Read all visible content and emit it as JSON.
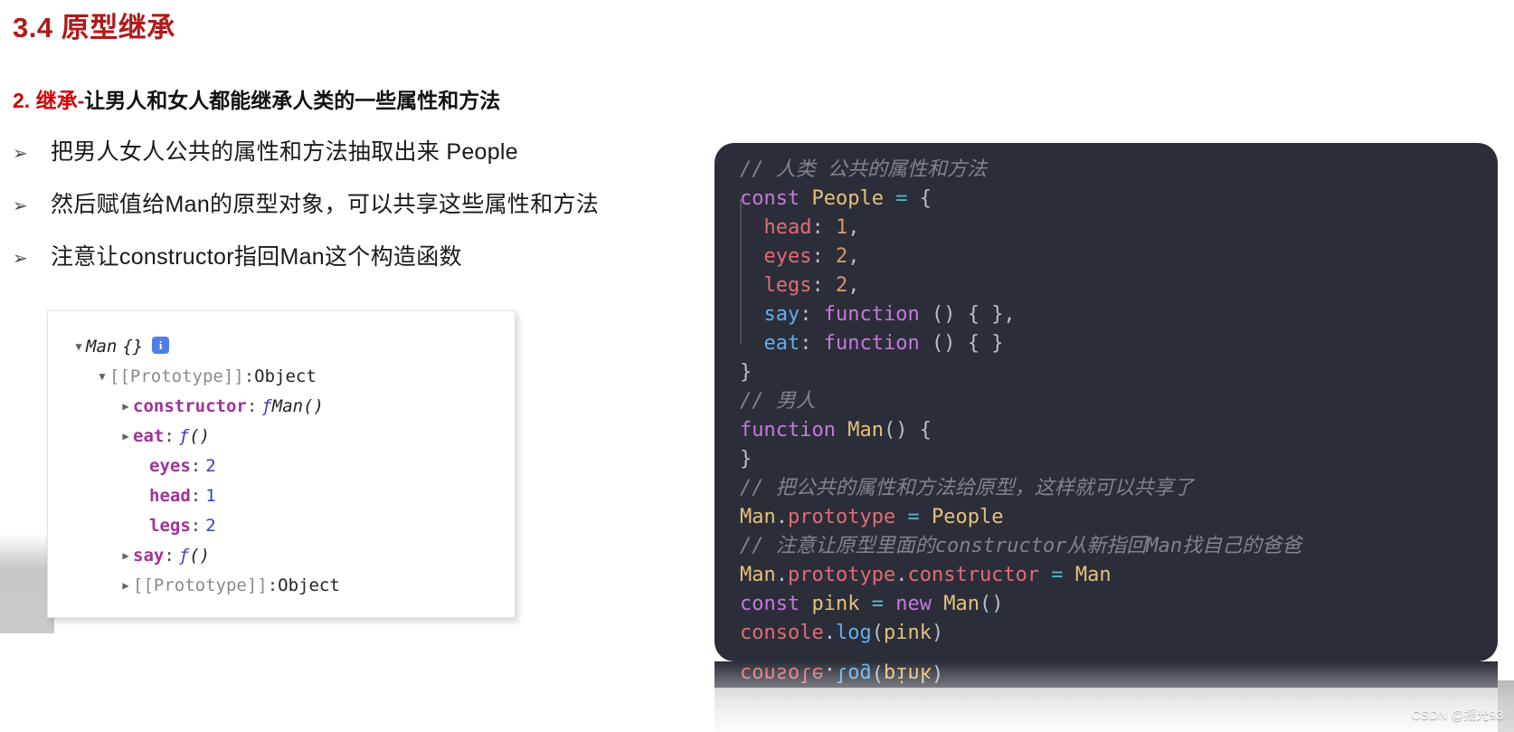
{
  "slide": {
    "section_title": "3.4 原型继承",
    "sub_heading_highlight": "2. 继承-",
    "sub_heading_rest": "让男人和女人都能继承人类的一些属性和方法",
    "accent_color": "#b01a1a",
    "highlight_color": "#d40000"
  },
  "bullets": [
    {
      "marker": "➢",
      "text": "把男人女人公共的属性和方法抽取出来 People"
    },
    {
      "marker": "➢",
      "text": "然后赋值给Man的原型对象，可以共享这些属性和方法"
    },
    {
      "marker": "➢",
      "text": "注意让constructor指回Man这个构造函数"
    }
  ],
  "devtools": {
    "root": {
      "arrow": "▼",
      "name": "Man",
      "braces": "{}",
      "badge": "i"
    },
    "rows": [
      {
        "arrow": "open",
        "indent": 1,
        "label": "[[Prototype]]",
        "colon": ":",
        "value": "Object",
        "kind": "proto"
      },
      {
        "arrow": "closed",
        "indent": 2,
        "label": "constructor",
        "colon": ":",
        "value": "Man()",
        "kind": "func",
        "fn": "ƒ"
      },
      {
        "arrow": "closed",
        "indent": 2,
        "label": "eat",
        "colon": ":",
        "value": "()",
        "kind": "func",
        "fn": "ƒ"
      },
      {
        "arrow": "blank",
        "indent": 3,
        "label": "eyes",
        "colon": ":",
        "value": "2",
        "kind": "num"
      },
      {
        "arrow": "blank",
        "indent": 3,
        "label": "head",
        "colon": ":",
        "value": "1",
        "kind": "num"
      },
      {
        "arrow": "blank",
        "indent": 3,
        "label": "legs",
        "colon": ":",
        "value": "2",
        "kind": "num"
      },
      {
        "arrow": "closed",
        "indent": 2,
        "label": "say",
        "colon": ":",
        "value": "()",
        "kind": "func",
        "fn": "ƒ"
      },
      {
        "arrow": "closed",
        "indent": 2,
        "label": "[[Prototype]]",
        "colon": ":",
        "value": "Object",
        "kind": "proto"
      }
    ]
  },
  "code": {
    "background": "#2b2e38",
    "lines": [
      [
        {
          "t": "// 人类 公共的属性和方法",
          "c": "c-comment"
        }
      ],
      [
        {
          "t": "const",
          "c": "c-kw"
        },
        {
          "t": " ",
          "c": "c-punc"
        },
        {
          "t": "People",
          "c": "c-var"
        },
        {
          "t": " ",
          "c": "c-punc"
        },
        {
          "t": "=",
          "c": "c-op"
        },
        {
          "t": " ",
          "c": "c-punc"
        },
        {
          "t": "{",
          "c": "c-punc"
        }
      ],
      [
        {
          "t": "  ",
          "c": "c-punc"
        },
        {
          "t": "head",
          "c": "c-prop"
        },
        {
          "t": ": ",
          "c": "c-punc"
        },
        {
          "t": "1",
          "c": "c-num"
        },
        {
          "t": ",",
          "c": "c-punc"
        }
      ],
      [
        {
          "t": "  ",
          "c": "c-punc"
        },
        {
          "t": "eyes",
          "c": "c-prop"
        },
        {
          "t": ": ",
          "c": "c-punc"
        },
        {
          "t": "2",
          "c": "c-num"
        },
        {
          "t": ",",
          "c": "c-punc"
        }
      ],
      [
        {
          "t": "  ",
          "c": "c-punc"
        },
        {
          "t": "legs",
          "c": "c-prop"
        },
        {
          "t": ": ",
          "c": "c-punc"
        },
        {
          "t": "2",
          "c": "c-num"
        },
        {
          "t": ",",
          "c": "c-punc"
        }
      ],
      [
        {
          "t": "  ",
          "c": "c-punc"
        },
        {
          "t": "say",
          "c": "c-fnkey"
        },
        {
          "t": ": ",
          "c": "c-punc"
        },
        {
          "t": "function",
          "c": "c-kw"
        },
        {
          "t": " () { },",
          "c": "c-punc"
        }
      ],
      [
        {
          "t": "  ",
          "c": "c-punc"
        },
        {
          "t": "eat",
          "c": "c-fnkey"
        },
        {
          "t": ": ",
          "c": "c-punc"
        },
        {
          "t": "function",
          "c": "c-kw"
        },
        {
          "t": " () { }",
          "c": "c-punc"
        }
      ],
      [
        {
          "t": "}",
          "c": "c-punc"
        }
      ],
      [
        {
          "t": "// 男人",
          "c": "c-comment"
        }
      ],
      [
        {
          "t": "function",
          "c": "c-kw"
        },
        {
          "t": " ",
          "c": "c-punc"
        },
        {
          "t": "Man",
          "c": "c-var"
        },
        {
          "t": "() {",
          "c": "c-punc"
        }
      ],
      [
        {
          "t": "}",
          "c": "c-punc"
        }
      ],
      [
        {
          "t": "// 把公共的属性和方法给原型，这样就可以共享了",
          "c": "c-comment"
        }
      ],
      [
        {
          "t": "Man",
          "c": "c-var"
        },
        {
          "t": ".",
          "c": "c-punc"
        },
        {
          "t": "prototype",
          "c": "c-prop"
        },
        {
          "t": " ",
          "c": "c-punc"
        },
        {
          "t": "=",
          "c": "c-op"
        },
        {
          "t": " ",
          "c": "c-punc"
        },
        {
          "t": "People",
          "c": "c-var"
        }
      ],
      [
        {
          "t": "// 注意让原型里面的constructor从新指回Man找自己的爸爸",
          "c": "c-comment"
        }
      ],
      [
        {
          "t": "Man",
          "c": "c-var"
        },
        {
          "t": ".",
          "c": "c-punc"
        },
        {
          "t": "prototype",
          "c": "c-prop"
        },
        {
          "t": ".",
          "c": "c-punc"
        },
        {
          "t": "constructor",
          "c": "c-prop"
        },
        {
          "t": " ",
          "c": "c-punc"
        },
        {
          "t": "=",
          "c": "c-op"
        },
        {
          "t": " ",
          "c": "c-punc"
        },
        {
          "t": "Man",
          "c": "c-var"
        }
      ],
      [
        {
          "t": "const",
          "c": "c-kw"
        },
        {
          "t": " ",
          "c": "c-punc"
        },
        {
          "t": "pink",
          "c": "c-var"
        },
        {
          "t": " ",
          "c": "c-punc"
        },
        {
          "t": "=",
          "c": "c-op"
        },
        {
          "t": " ",
          "c": "c-punc"
        },
        {
          "t": "new",
          "c": "c-kw"
        },
        {
          "t": " ",
          "c": "c-punc"
        },
        {
          "t": "Man",
          "c": "c-var"
        },
        {
          "t": "()",
          "c": "c-punc"
        }
      ],
      [
        {
          "t": "console",
          "c": "c-prop"
        },
        {
          "t": ".",
          "c": "c-punc"
        },
        {
          "t": "log",
          "c": "c-fnkey"
        },
        {
          "t": "(",
          "c": "c-punc"
        },
        {
          "t": "pink",
          "c": "c-var"
        },
        {
          "t": ")",
          "c": "c-punc"
        }
      ]
    ],
    "reflection_line": [
      {
        "t": "console",
        "c": "c-prop"
      },
      {
        "t": ".",
        "c": "c-punc"
      },
      {
        "t": "log",
        "c": "c-fnkey"
      },
      {
        "t": "(",
        "c": "c-punc"
      },
      {
        "t": "pink",
        "c": "c-var"
      },
      {
        "t": ")",
        "c": "c-punc"
      }
    ]
  },
  "watermark": "CSDN @摇光93"
}
